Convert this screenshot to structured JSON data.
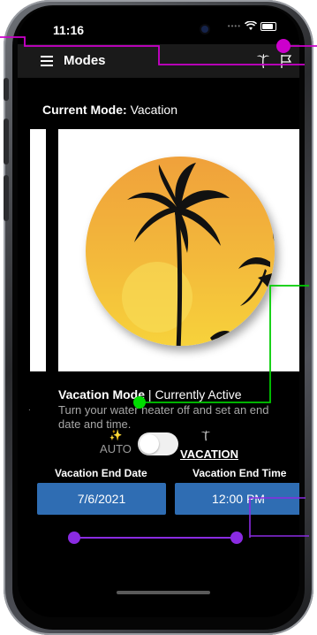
{
  "status_bar": {
    "time": "11:16",
    "signal_icon": "signal-dots-icon",
    "wifi_icon": "wifi-icon",
    "battery_icon": "battery-icon"
  },
  "app_bar": {
    "title": "Modes",
    "menu_icon": "menu-icon",
    "actions": [
      "palm-tree-icon",
      "flag-icon"
    ]
  },
  "current_mode": {
    "label": "Current Mode:",
    "value": "Vacation"
  },
  "mode_card": {
    "image": "palm-tree-sunset",
    "title": "Vacation Mode",
    "status": "| Currently Active",
    "description": "Turn your water heater off and set an end date and time."
  },
  "mode_toggle": {
    "left_label": "AUTO",
    "left_icon": "wand-icon",
    "right_label": "VACATION",
    "right_icon": "palm-tree-icon",
    "selected": "VACATION"
  },
  "end_date": {
    "label": "Vacation End Date",
    "value": "7/6/2021"
  },
  "end_time": {
    "label": "Vacation End Time",
    "value": "12:00 PM"
  },
  "colors": {
    "background": "#000000",
    "app_bar": "#1a1a1a",
    "button": "#2f6db3",
    "sun_gradient_top": "#f0a13a",
    "sun_gradient_bottom": "#f7d23a",
    "annotation_magenta": "#cc00cc",
    "annotation_green": "#00dd00",
    "annotation_purple": "#8a2be2"
  }
}
